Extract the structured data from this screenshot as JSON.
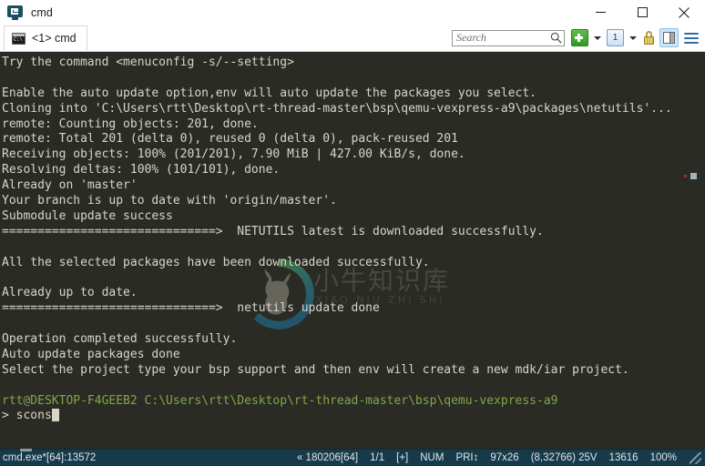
{
  "window": {
    "title": "cmd",
    "app_icon": "terminal-monitor-icon",
    "minimize_label": "─",
    "maximize_label": "□",
    "close_label": "✕"
  },
  "tabbar": {
    "tabs": [
      {
        "label": "<1> cmd",
        "icon": "console-icon",
        "active": true
      }
    ],
    "search": {
      "placeholder": "Search",
      "value": "",
      "icon": "search-icon"
    },
    "buttons": [
      {
        "name": "new-console-button",
        "icon": "green-plus-icon",
        "label": ""
      },
      {
        "name": "new-console-dropdown",
        "icon": "chevron-down-icon",
        "label": ""
      },
      {
        "name": "active-console-button",
        "icon": "window-number-icon",
        "label": "1"
      },
      {
        "name": "active-console-dropdown",
        "icon": "chevron-down-icon",
        "label": ""
      },
      {
        "name": "lock-button",
        "icon": "lock-icon",
        "label": ""
      },
      {
        "name": "split-pane-button",
        "icon": "split-pane-icon",
        "label": ""
      },
      {
        "name": "main-menu-button",
        "icon": "hamburger-icon",
        "label": ""
      }
    ]
  },
  "terminal": {
    "colors": {
      "background": "#2b2b26",
      "foreground": "#d9d5c7",
      "prompt_green": "#7fa844"
    },
    "lines": [
      {
        "text": "Try the command <menuconfig -s/--setting>",
        "color": "gray"
      },
      {
        "text": "",
        "color": "gray"
      },
      {
        "text": "Enable the auto update option,env will auto update the packages you select.",
        "color": "gray"
      },
      {
        "text": "Cloning into 'C:\\Users\\rtt\\Desktop\\rt-thread-master\\bsp\\qemu-vexpress-a9\\packages\\netutils'...",
        "color": "gray"
      },
      {
        "text": "remote: Counting objects: 201, done.",
        "color": "gray"
      },
      {
        "text": "remote: Total 201 (delta 0), reused 0 (delta 0), pack-reused 201",
        "color": "gray"
      },
      {
        "text": "Receiving objects: 100% (201/201), 7.90 MiB | 427.00 KiB/s, done.",
        "color": "gray"
      },
      {
        "text": "Resolving deltas: 100% (101/101), done.",
        "color": "gray"
      },
      {
        "text": "Already on 'master'",
        "color": "gray"
      },
      {
        "text": "Your branch is up to date with 'origin/master'.",
        "color": "gray"
      },
      {
        "text": "Submodule update success",
        "color": "gray"
      },
      {
        "text": "==============================>  NETUTILS latest is downloaded successfully.",
        "color": "gray"
      },
      {
        "text": "",
        "color": "gray"
      },
      {
        "text": "All the selected packages have been downloaded successfully.",
        "color": "gray"
      },
      {
        "text": "",
        "color": "gray"
      },
      {
        "text": "Already up to date.",
        "color": "gray"
      },
      {
        "text": "==============================>  netutils update done",
        "color": "gray"
      },
      {
        "text": "",
        "color": "gray"
      },
      {
        "text": "Operation completed successfully.",
        "color": "gray"
      },
      {
        "text": "Auto update packages done",
        "color": "gray"
      },
      {
        "text": "Select the project type your bsp support and then env will create a new mdk/iar project.",
        "color": "gray"
      },
      {
        "text": "",
        "color": "gray"
      }
    ],
    "prompt": {
      "user_host": "rtt@DESKTOP-F4GEEB2",
      "path": "C:\\Users\\rtt\\Desktop\\rt-thread-master\\bsp\\qemu-vexpress-a9",
      "symbol": ">",
      "command": "scons"
    },
    "watermark": {
      "text": "小牛知识库",
      "subtext": "XIAO NIU ZHI SHI",
      "logo": "bull-circle-logo"
    }
  },
  "statusbar": {
    "left": "cmd.exe*[64]:13572",
    "items": [
      "« 180206[64]",
      "1/1",
      "[+]",
      "NUM",
      "PRI↕",
      "97x26",
      "(8,32766) 25V",
      "13616",
      "100%"
    ]
  }
}
